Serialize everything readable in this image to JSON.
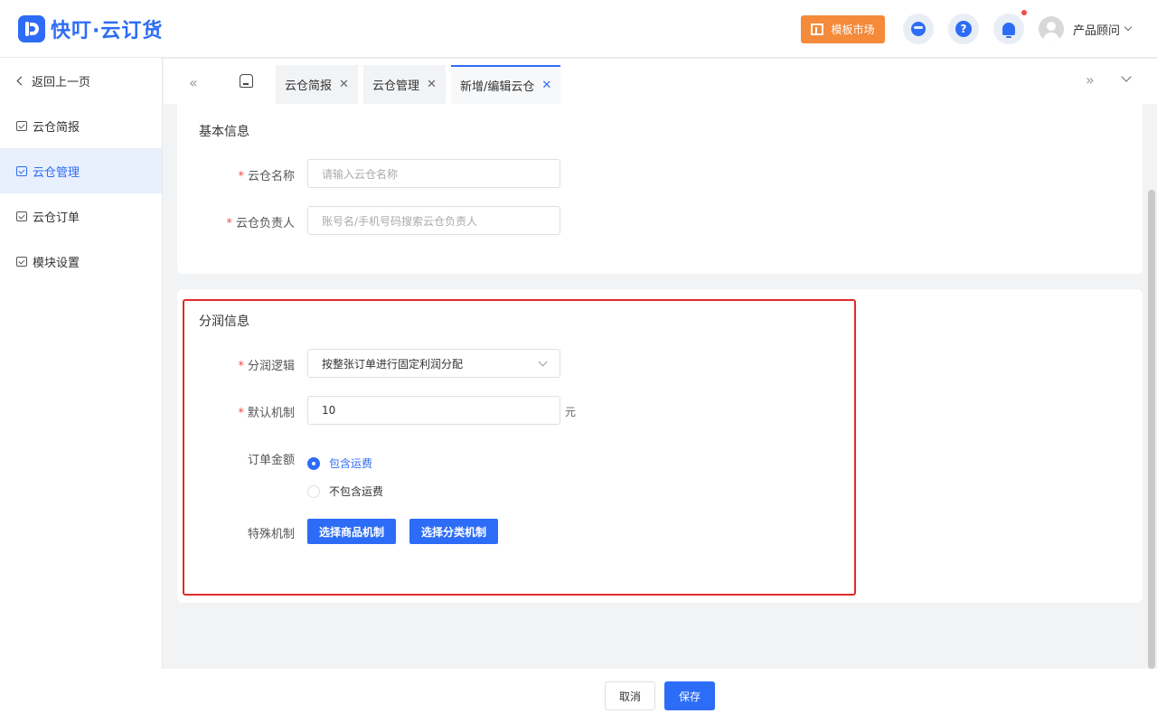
{
  "header": {
    "logo_text": "快叮·云订货",
    "template_market": "模板市场",
    "user_name": "产品顾问"
  },
  "sidebar": {
    "back": "返回上一页",
    "items": [
      {
        "label": "云仓简报"
      },
      {
        "label": "云仓管理"
      },
      {
        "label": "云仓订单"
      },
      {
        "label": "模块设置"
      }
    ],
    "active": "云仓管理"
  },
  "tabs": [
    {
      "label": "云仓简报"
    },
    {
      "label": "云仓管理"
    },
    {
      "label": "新增/编辑云仓"
    }
  ],
  "basic": {
    "title": "基本信息",
    "name_label": "云仓名称",
    "name_placeholder": "请输入云仓名称",
    "owner_label": "云仓负责人",
    "owner_placeholder": "账号名/手机号码搜索云仓负责人"
  },
  "profit": {
    "title": "分润信息",
    "logic_label": "分润逻辑",
    "logic_value": "按整张订单进行固定利润分配",
    "default_label": "默认机制",
    "default_value": "10",
    "default_unit": "元",
    "order_amount_label": "订单金额",
    "radio_include": "包含运费",
    "radio_exclude": "不包含运费",
    "selected_radio": "包含运费",
    "special_label": "特殊机制",
    "btn_goods": "选择商品机制",
    "btn_category": "选择分类机制"
  },
  "footer": {
    "cancel": "取消",
    "save": "保存"
  },
  "colors": {
    "primary": "#2d6cf6",
    "accent_orange": "#f48a3a",
    "highlight_red": "#e02b2b"
  }
}
